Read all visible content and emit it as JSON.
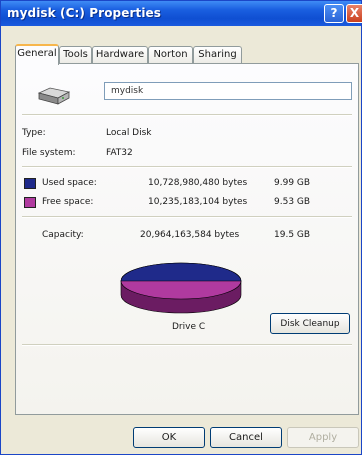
{
  "window": {
    "title": "mydisk (C:) Properties",
    "help_label": "?",
    "close_label": "X"
  },
  "tabs": [
    {
      "label": "General",
      "active": true
    },
    {
      "label": "Tools"
    },
    {
      "label": "Hardware"
    },
    {
      "label": "Norton"
    },
    {
      "label": "Sharing"
    }
  ],
  "general": {
    "drive_icon": "hard-drive-icon",
    "name_value": "mydisk",
    "type_label": "Type:",
    "type_value": "Local Disk",
    "fs_label": "File system:",
    "fs_value": "FAT32",
    "used": {
      "label": "Used space:",
      "bytes": "10,728,980,480 bytes",
      "size": "9.99 GB",
      "color": "#1f2a8a"
    },
    "free": {
      "label": "Free space:",
      "bytes": "10,235,183,104 bytes",
      "size": "9.53 GB",
      "color": "#b03a9f"
    },
    "capacity": {
      "label": "Capacity:",
      "bytes": "20,964,163,584 bytes",
      "size": "19.5 GB"
    },
    "drive_label": "Drive C",
    "cleanup_label": "Disk Cleanup"
  },
  "buttons": {
    "ok": "OK",
    "cancel": "Cancel",
    "apply": "Apply"
  }
}
